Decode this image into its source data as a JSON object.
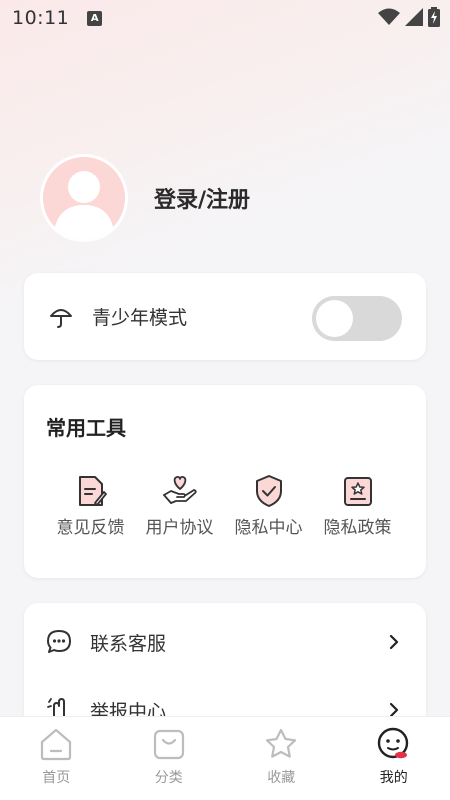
{
  "status_bar": {
    "time": "10:11",
    "notification_icon": "a-icon"
  },
  "profile": {
    "login_label": "登录/注册"
  },
  "teen_mode": {
    "label": "青少年模式",
    "enabled": false
  },
  "tools": {
    "title": "常用工具",
    "items": [
      {
        "label": "意见反馈",
        "icon": "feedback-document-icon"
      },
      {
        "label": "用户协议",
        "icon": "heart-hand-icon"
      },
      {
        "label": "隐私中心",
        "icon": "shield-check-icon"
      },
      {
        "label": "隐私政策",
        "icon": "policy-star-icon"
      }
    ]
  },
  "menu": {
    "items": [
      {
        "label": "联系客服",
        "icon": "chat-bubble-icon"
      },
      {
        "label": "举报中心",
        "icon": "report-hand-icon"
      }
    ]
  },
  "tabbar": {
    "items": [
      {
        "label": "首页",
        "icon": "home-icon",
        "active": false
      },
      {
        "label": "分类",
        "icon": "category-bag-icon",
        "active": false
      },
      {
        "label": "收藏",
        "icon": "star-icon",
        "active": false
      },
      {
        "label": "我的",
        "icon": "profile-face-icon",
        "active": true
      }
    ]
  },
  "colors": {
    "accent": "#e0334a",
    "icon_fill": "#fbd7d6",
    "toggle_off": "#d9d9d9"
  }
}
